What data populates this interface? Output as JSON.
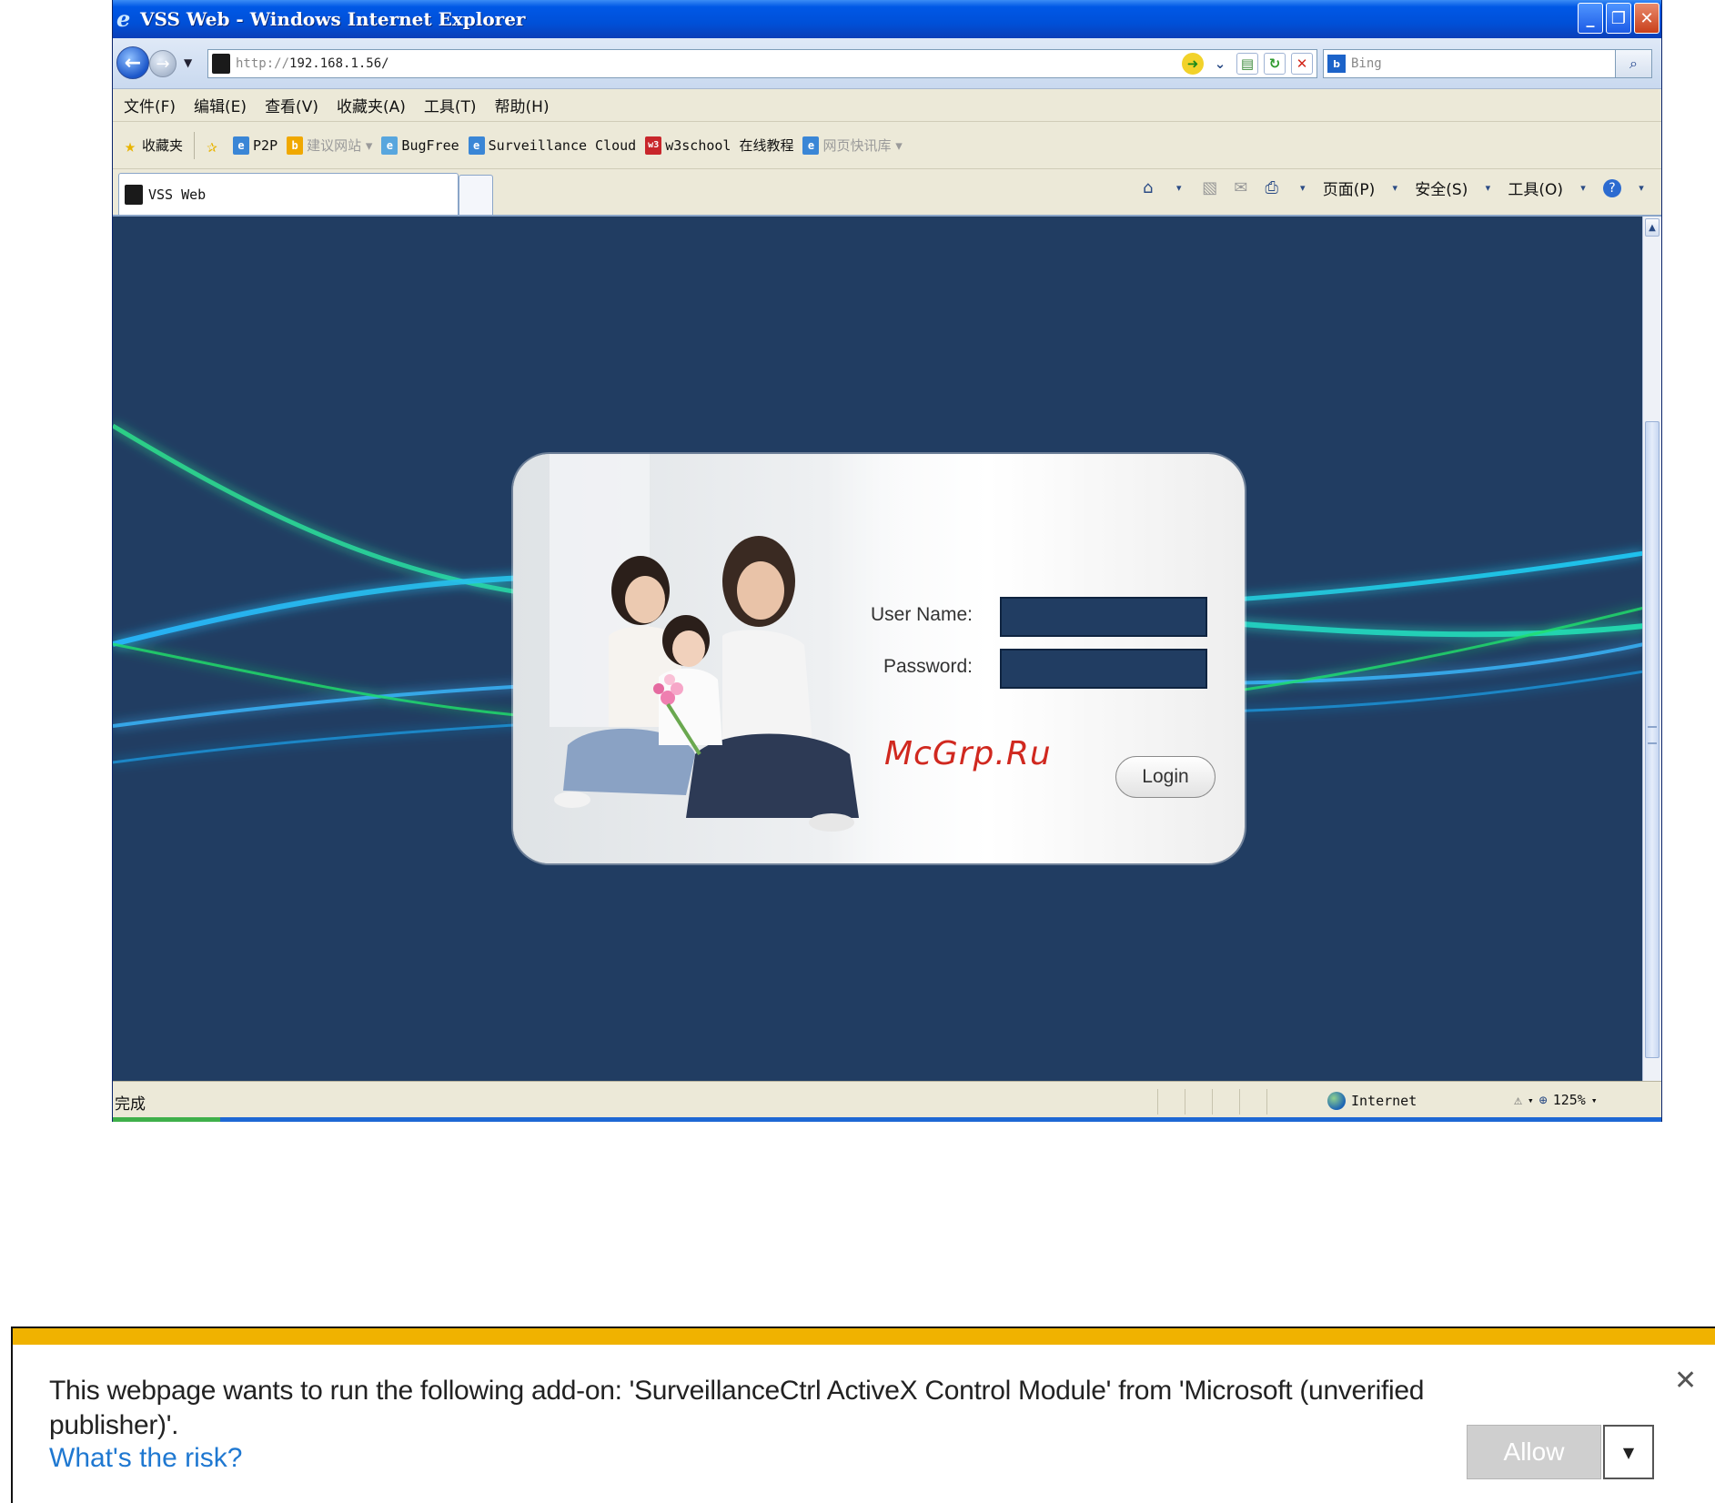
{
  "browser": {
    "window_title": "VSS Web - Windows Internet Explorer",
    "address": {
      "prefix": "http://",
      "host": "192.168.1.56/"
    },
    "search_placeholder": "Bing",
    "menu": [
      "文件(F)",
      "编辑(E)",
      "查看(V)",
      "收藏夹(A)",
      "工具(T)",
      "帮助(H)"
    ],
    "favorites_label": "收藏夹",
    "favorites": [
      {
        "label": "P2P",
        "icon": "ie-page-icon"
      },
      {
        "label": "建议网站 ▾",
        "icon": "bing-icon"
      },
      {
        "label": "BugFree",
        "icon": "bugfree-icon"
      },
      {
        "label": "Surveillance Cloud",
        "icon": "ie-page-icon"
      },
      {
        "label": "w3school 在线教程",
        "icon": "w3school-icon"
      },
      {
        "label": "网页快讯库 ▾",
        "icon": "ie-page-icon"
      }
    ],
    "tab_label": "VSS Web",
    "command_bar": {
      "page": "页面(P)",
      "safety": "安全(S)",
      "tools": "工具(O)"
    },
    "status_text": "完成",
    "zone": "Internet",
    "zoom": "125%"
  },
  "login": {
    "username_label": "User Name:",
    "password_label": "Password:",
    "username_value": "",
    "password_value": "",
    "login_button": "Login"
  },
  "watermark": "McGrp.Ru",
  "notification": {
    "message": "This webpage wants to run the following add-on: 'SurveillanceCtrl ActiveX Control Module' from 'Microsoft (unverified publisher)'.",
    "risk_link": "What's the risk?",
    "allow_button": "Allow"
  },
  "colors": {
    "page_background": "#213d62",
    "notification_stripe": "#f0b200",
    "watermark": "#d0281f",
    "link": "#1f78d1"
  }
}
